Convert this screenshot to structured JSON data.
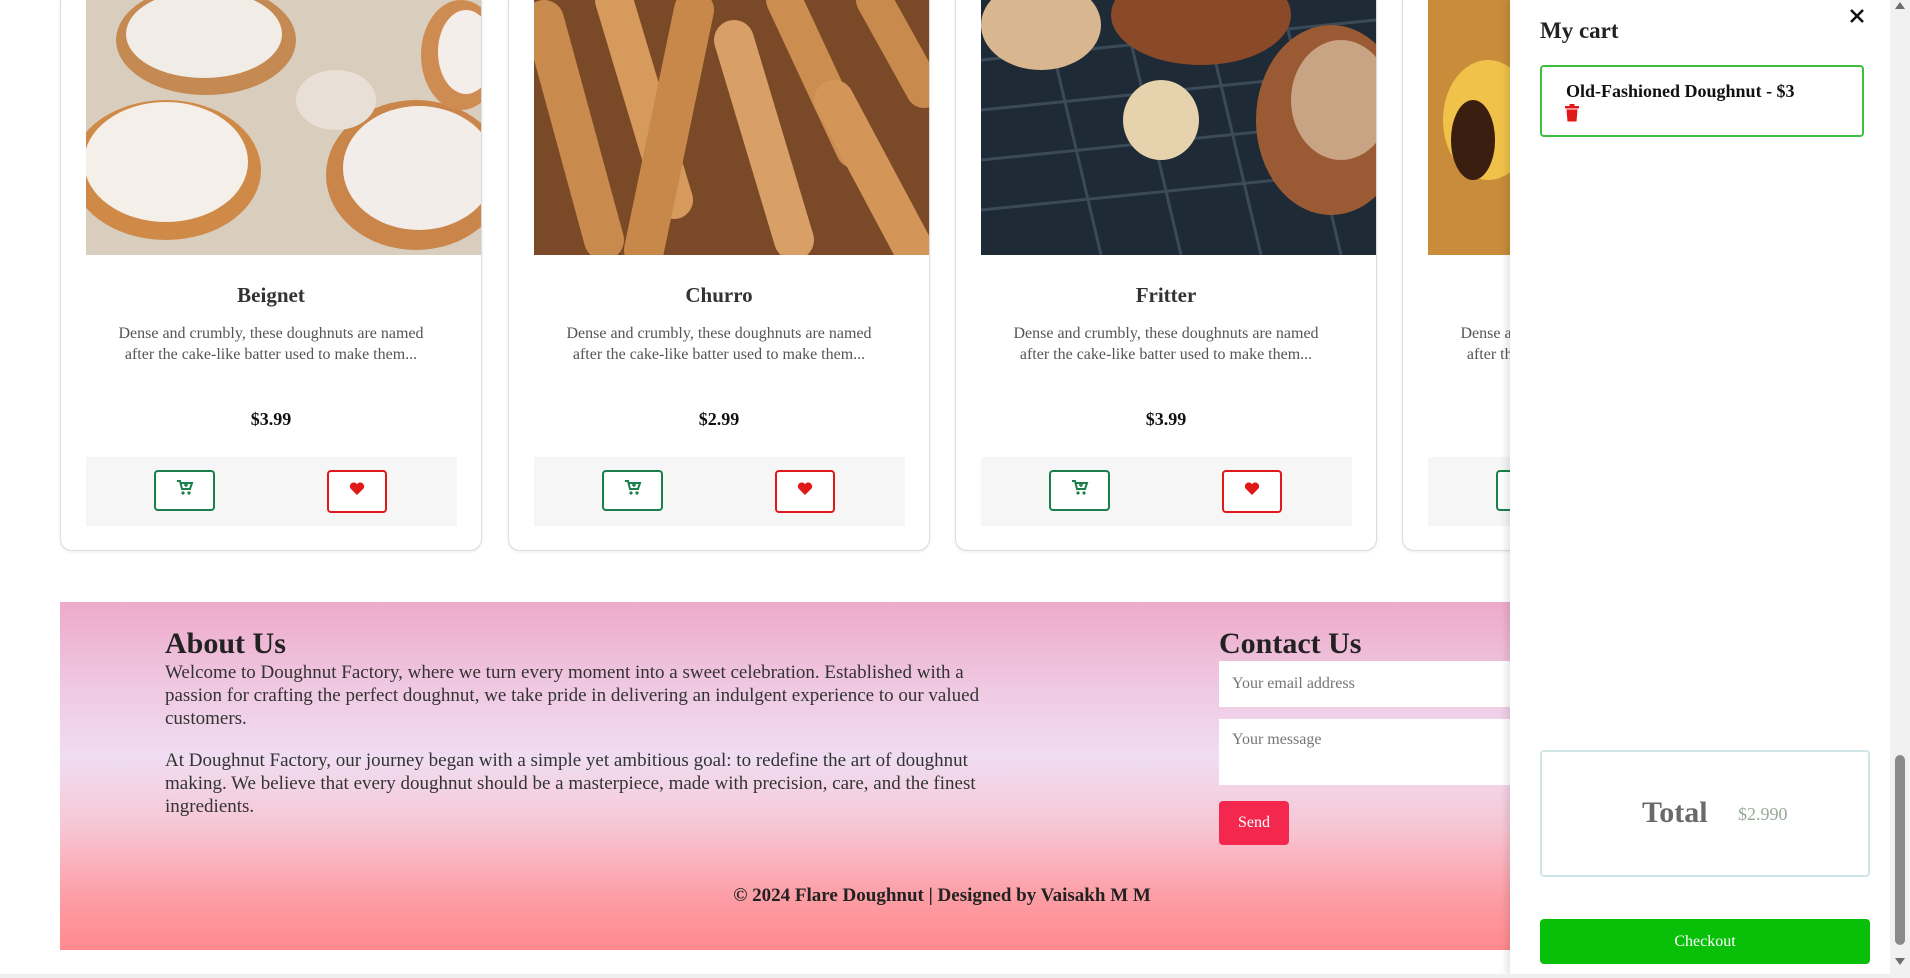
{
  "products": [
    {
      "name": "Beignet",
      "description": "Dense and crumbly, these doughnuts are named after the cake-like batter used to make them...",
      "price": "$3.99"
    },
    {
      "name": "Churro",
      "description": "Dense and crumbly, these doughnuts are named after the cake-like batter used to make them...",
      "price": "$2.99"
    },
    {
      "name": "Fritter",
      "description": "Dense and crumbly, these doughnuts are named after the cake-like batter used to make them...",
      "price": "$3.99"
    },
    {
      "name": "",
      "description": "Dense and crumbly, these doughnuts are named after the cake-like batter used to make them...",
      "price": ""
    }
  ],
  "product_icons": {
    "cart": "add-to-cart-icon",
    "favorite": "heart-icon"
  },
  "footer": {
    "about_title": "About Us",
    "about_p1": "Welcome to Doughnut Factory, where we turn every moment into a sweet celebration. Established with a passion for crafting the perfect doughnut, we take pride in delivering an indulgent experience to our valued customers.",
    "about_p2": "At Doughnut Factory, our journey began with a simple yet ambitious goal: to redefine the art of doughnut making. We believe that every doughnut should be a masterpiece, made with precision, care, and the finest ingredients.",
    "contact_title": "Contact Us",
    "email_placeholder": "Your email address",
    "message_placeholder": "Your message",
    "send_label": "Send",
    "copyright": "© 2024 Flare Doughnut | Designed by Vaisakh M M"
  },
  "cart": {
    "title": "My cart",
    "items": [
      {
        "label": "Old-Fashioned Doughnut - $3"
      }
    ],
    "total_label": "Total",
    "total_value": "$2.990",
    "checkout_label": "Checkout"
  },
  "colors": {
    "cart_button": "#1a7f4b",
    "favorite_button": "#e01818",
    "send_button": "#f4284f",
    "checkout_button": "#08c008",
    "cart_item_border": "#3fbf3f"
  }
}
